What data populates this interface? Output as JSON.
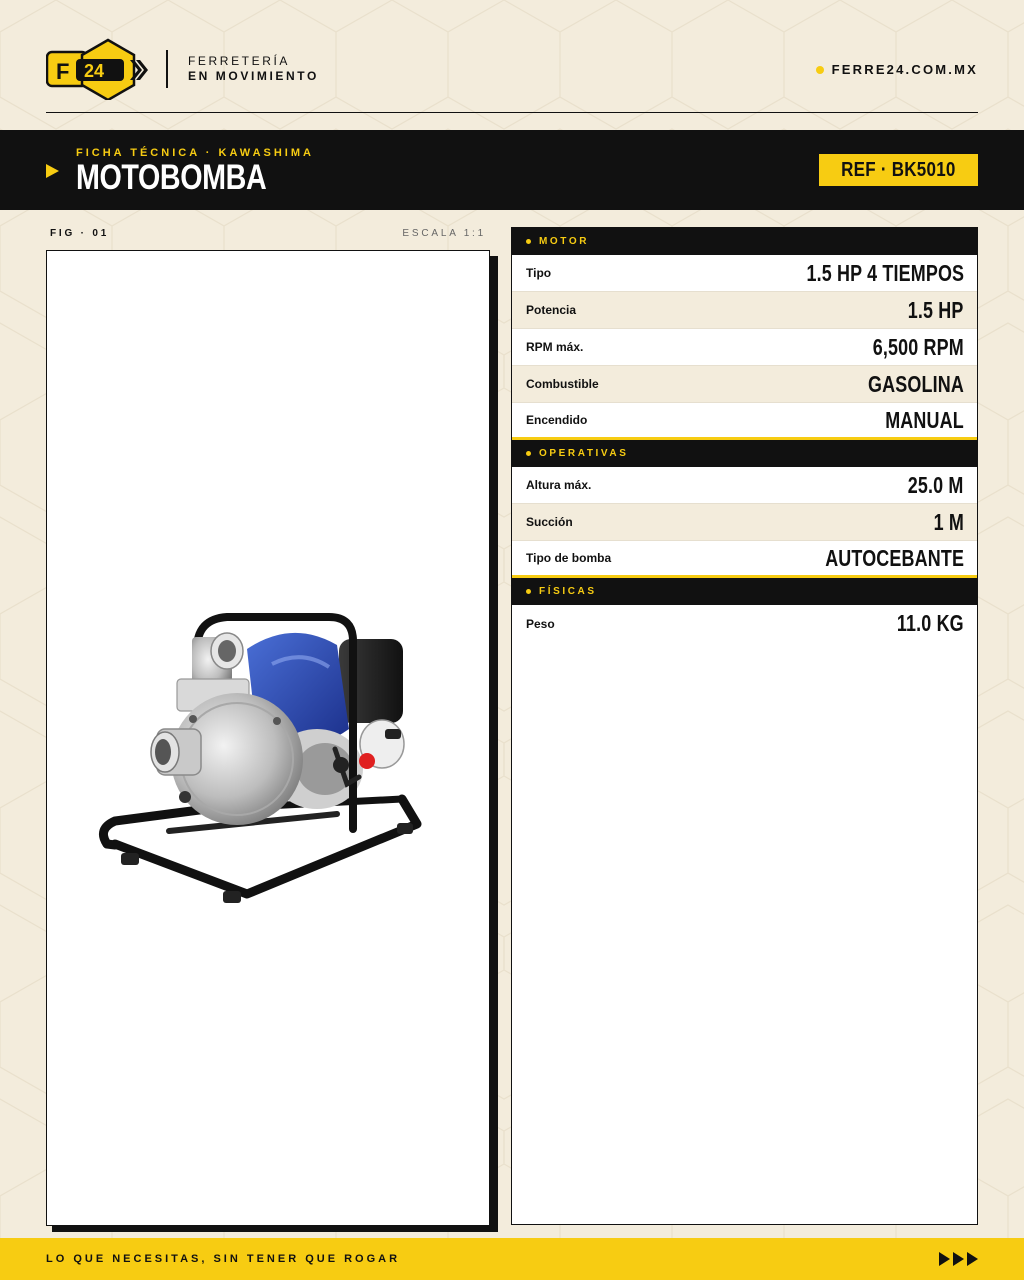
{
  "brand": {
    "logo_letters": "F",
    "logo_number": "24",
    "tagline_line1": "FERRETERÍA",
    "tagline_line2": "EN MOVIMIENTO",
    "website": "FERRE24.COM.MX",
    "accent_color": "#f7cc12",
    "dark_color": "#111111",
    "background_color": "#f3ecdc"
  },
  "title_band": {
    "kicker": "FICHA TÉCNICA · KAWASHIMA",
    "title": "MOTOBOMBA",
    "ref": "REF · BK5010"
  },
  "figure": {
    "label": "FIG · 01",
    "scale": "ESCALA 1:1",
    "image_subject": "gasoline-water-pump"
  },
  "specs": {
    "motor": {
      "heading": "MOTOR",
      "rows": [
        {
          "label": "Tipo",
          "value": "1.5 HP 4 TIEMPOS"
        },
        {
          "label": "Potencia",
          "value": "1.5 HP"
        },
        {
          "label": "RPM máx.",
          "value": "6,500 RPM"
        },
        {
          "label": "Combustible",
          "value": "GASOLINA"
        },
        {
          "label": "Encendido",
          "value": "MANUAL"
        }
      ]
    },
    "operativas": {
      "heading": "OPERATIVAS",
      "rows": [
        {
          "label": "Altura máx.",
          "value": "25.0 M"
        },
        {
          "label": "Succión",
          "value": "1 M"
        },
        {
          "label": "Tipo de bomba",
          "value": "AUTOCEBANTE"
        }
      ]
    },
    "fisicas": {
      "heading": "FÍSICAS",
      "rows": [
        {
          "label": "Peso",
          "value": "11.0 KG"
        }
      ]
    }
  },
  "footer": {
    "slogan": "LO QUE NECESITAS, SIN TENER QUE ROGAR",
    "arrows_icon": "triple-play-arrows-icon"
  }
}
